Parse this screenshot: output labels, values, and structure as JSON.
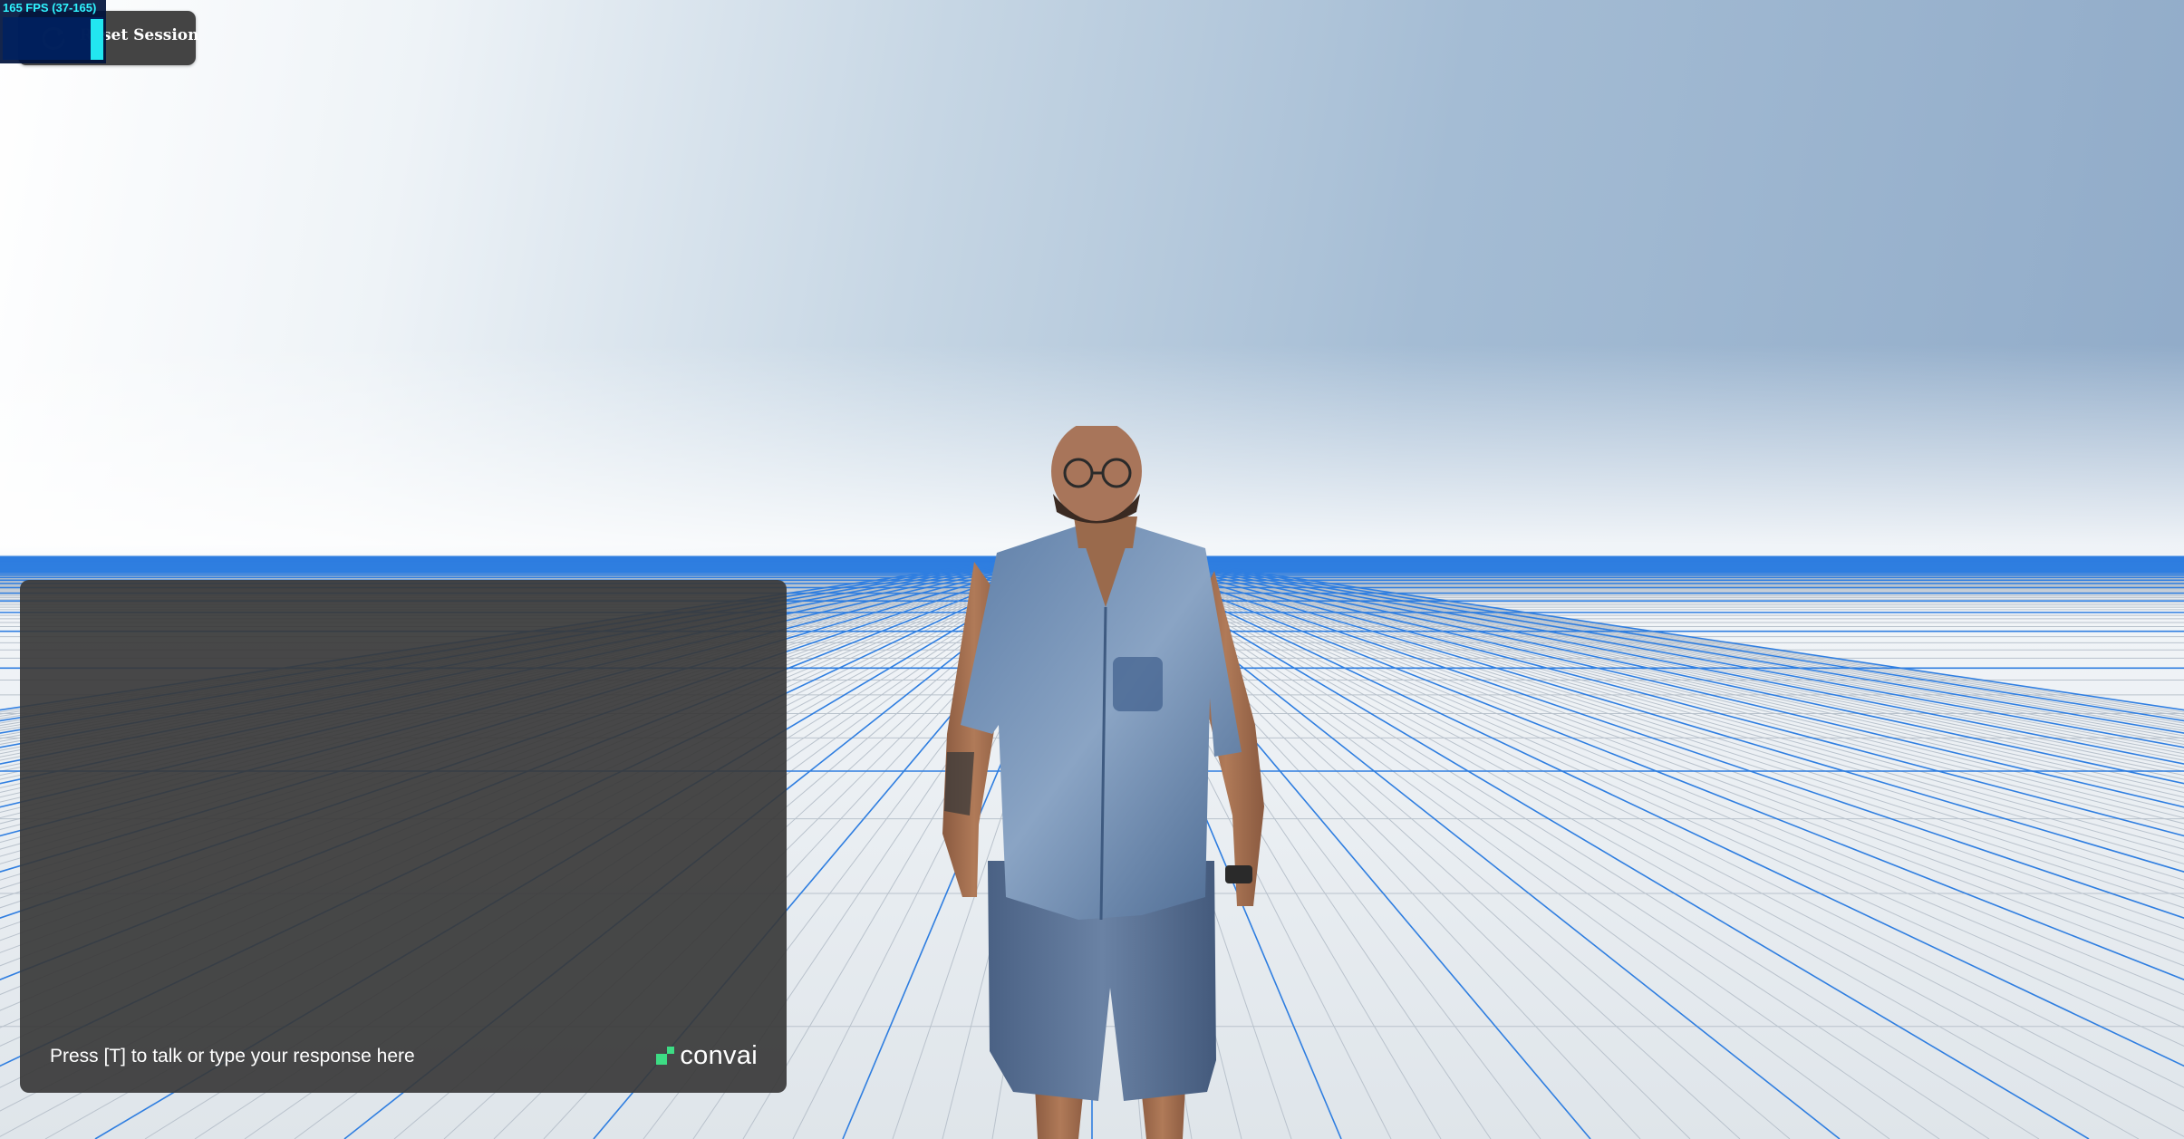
{
  "fps_meter": {
    "label": "165 FPS (37-165)",
    "fps_fraction_of_max": 1.0
  },
  "reset_button": {
    "label": "Reset Session",
    "icon": "refresh-icon"
  },
  "chat": {
    "placeholder": "Press [T] to talk or type your response here",
    "value": ""
  },
  "branding": {
    "logo_text": "convai",
    "logo_color": "#3ddc84"
  },
  "colors": {
    "grid_major": "#2f7ee0",
    "grid_minor": "#b9c2cc",
    "panel_bg": "#383838",
    "fps_text": "#2ff4ff"
  }
}
